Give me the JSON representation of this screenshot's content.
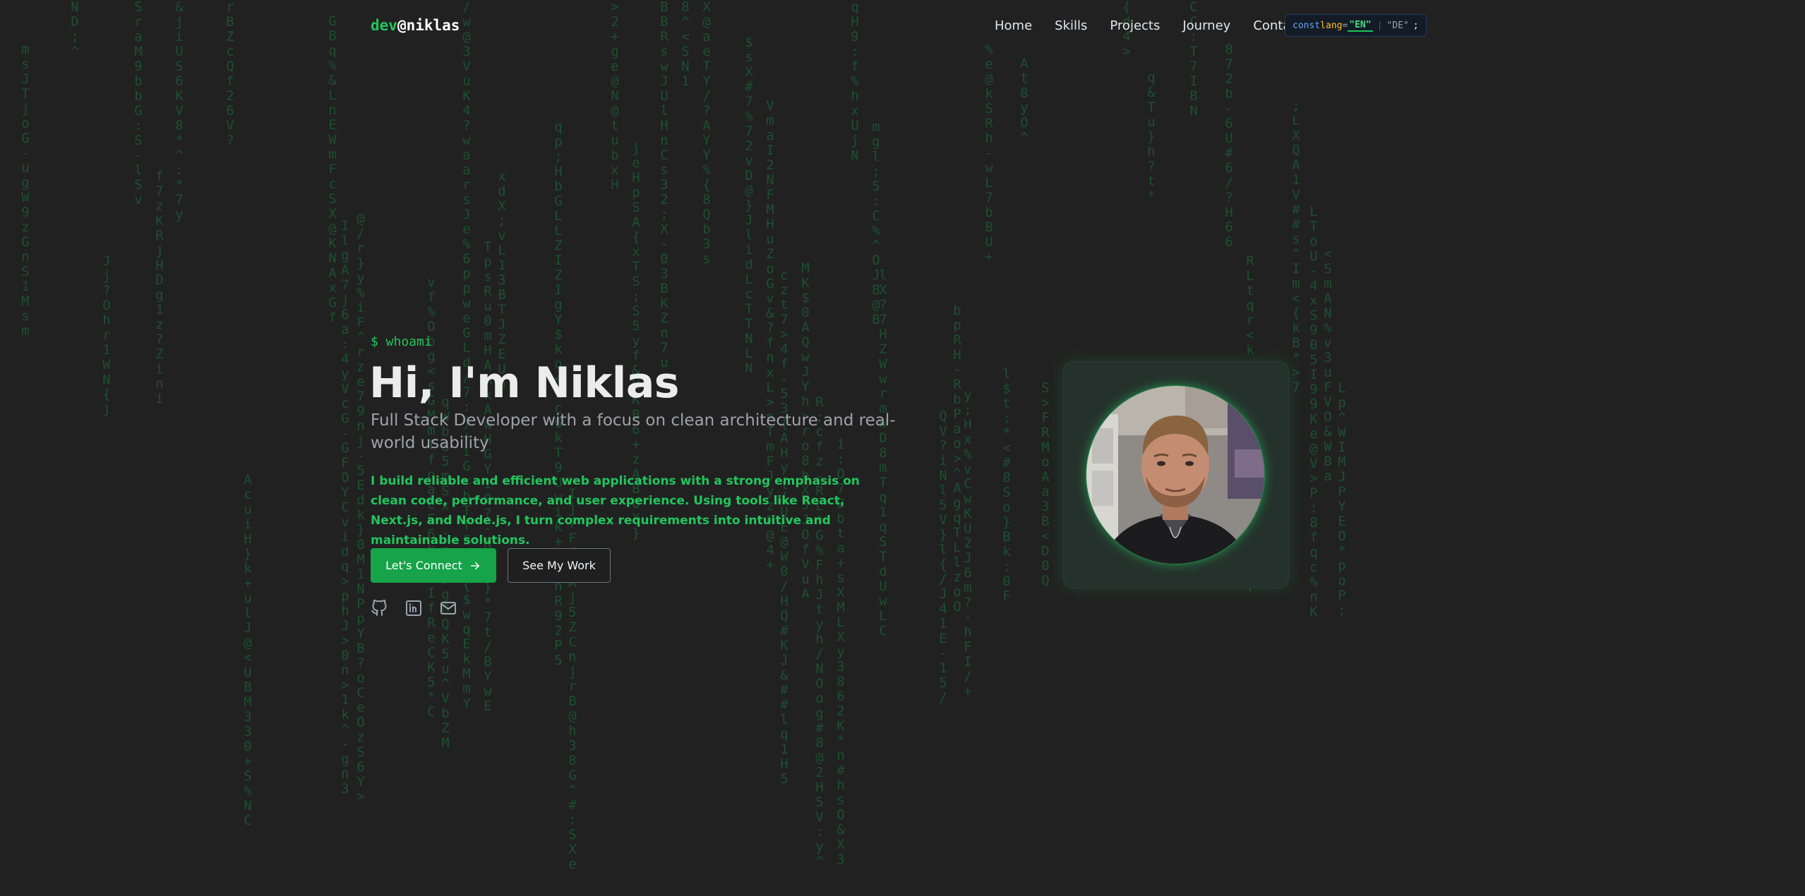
{
  "nav": {
    "logo_prefix": "dev",
    "logo_suffix": "@niklas",
    "links": [
      "Home",
      "Skills",
      "Projects",
      "Journey",
      "Contact"
    ],
    "lang": {
      "keyword": "const",
      "variable": "lang",
      "equals": "=",
      "active": "\"EN\"",
      "separator": "|",
      "inactive": "\"DE\"",
      "terminator": ";"
    }
  },
  "hero": {
    "prompt": "$ whoami",
    "title": "Hi, I'm Niklas",
    "subtitle": "Full Stack Developer with a focus on clean architecture and real-world usability",
    "description": "I build reliable and efficient web applications with a strong emphasis on clean code, performance, and user experience. Using tools like React, Next.js, and Node.js, I turn complex requirements into intuitive and maintainable solutions.",
    "primary_button": "Let's Connect",
    "secondary_button": "See My Work",
    "socials": [
      "github-icon",
      "linkedin-icon",
      "mail-icon"
    ]
  },
  "colors": {
    "background": "#212121",
    "accent": "#22c55e",
    "button": "#16a34a",
    "muted_text": "#a1a1aa"
  }
}
